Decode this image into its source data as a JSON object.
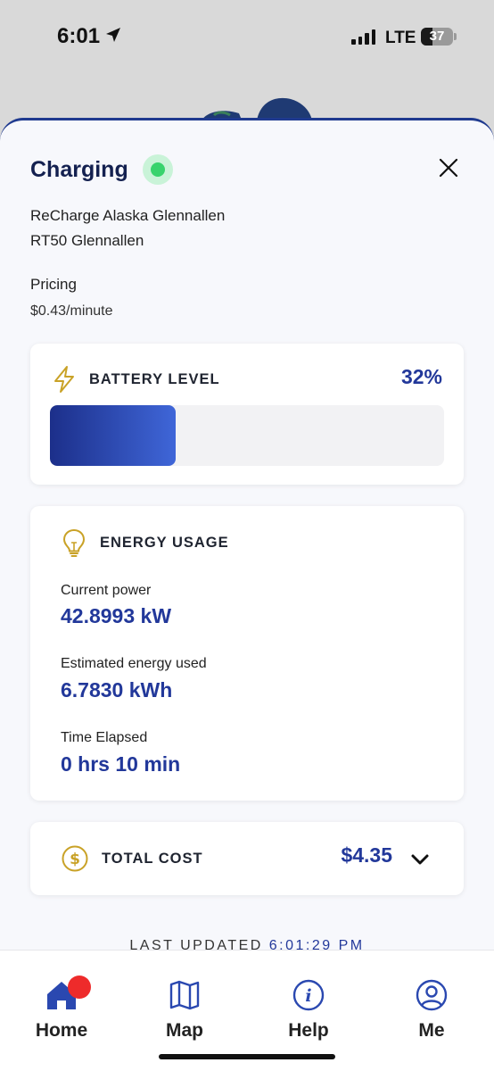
{
  "status_bar": {
    "time": "6:01",
    "network": "LTE",
    "battery_level": "37"
  },
  "sheet": {
    "title": "Charging",
    "station_name": "ReCharge Alaska Glennallen",
    "station_address": "RT50 Glennallen",
    "pricing_label": "Pricing",
    "pricing_value": "$0.43/minute"
  },
  "battery_card": {
    "title": "BATTERY LEVEL",
    "percent_text": "32%",
    "level_fraction": 0.32
  },
  "energy_card": {
    "title": "ENERGY USAGE",
    "metrics": [
      {
        "label": "Current power",
        "value": "42.8993 kW"
      },
      {
        "label": "Estimated energy used",
        "value": "6.7830 kWh"
      },
      {
        "label": "Time Elapsed",
        "value": "0 hrs 10 min"
      }
    ]
  },
  "cost_card": {
    "title": "TOTAL COST",
    "value": "$4.35"
  },
  "last_updated": {
    "label": "LAST UPDATED",
    "time": "6:01:29 PM"
  },
  "tabs": [
    {
      "label": "Home",
      "icon": "home-icon"
    },
    {
      "label": "Map",
      "icon": "map-icon"
    },
    {
      "label": "Help",
      "icon": "info-icon"
    },
    {
      "label": "Me",
      "icon": "user-icon"
    }
  ],
  "colors": {
    "accent": "#22389a",
    "title": "#142150",
    "status_green": "#38d36d",
    "icon_gold": "#c9a227",
    "badge_red": "#ee2b2b"
  }
}
